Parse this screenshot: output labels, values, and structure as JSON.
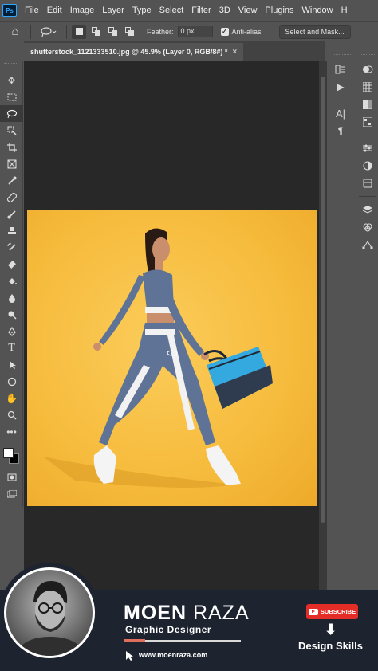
{
  "app": {
    "logo": "Ps"
  },
  "menu": [
    "File",
    "Edit",
    "Image",
    "Layer",
    "Type",
    "Select",
    "Filter",
    "3D",
    "View",
    "Plugins",
    "Window",
    "H"
  ],
  "options": {
    "feather_label": "Feather:",
    "feather_value": "0 px",
    "antialias_label": "Anti-alias",
    "antialias_checked": true,
    "select_mask_label": "Select and Mask..."
  },
  "document": {
    "tab_title": "shutterstock_1121333510.jpg @ 45.9% (Layer 0, RGB/8#) *"
  },
  "colors": {
    "foreground": "#ffffff",
    "background": "#000000",
    "canvas_bg": "#f6bb3c"
  },
  "branding": {
    "name_first": "MOEN",
    "name_last": "RAZA",
    "role": "Graphic Designer",
    "url": "www.moenraza.com",
    "subscribe": "SUBSCRIBE",
    "channel": "Design Skills"
  }
}
